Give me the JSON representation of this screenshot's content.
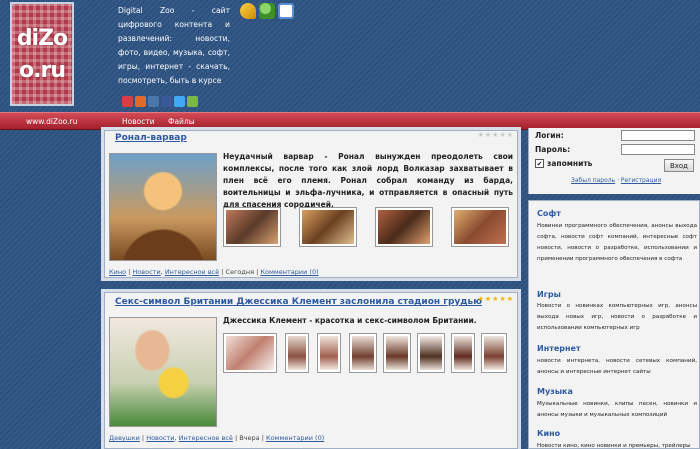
{
  "header": {
    "logo_text_1": "diZo",
    "logo_text_2": "o.ru",
    "description": "Digital Zoo - сайт цифрового контента и развлечений: новости, фото, видео, музыка, софт, игры, интернет - скачать, посмотреть, быть в курсе",
    "icons": [
      "key-icon",
      "user-add-icon",
      "rss-icon"
    ],
    "social_icons": [
      "social-icon-1",
      "social-icon-2",
      "vkontakte-icon",
      "facebook-icon",
      "twitter-icon",
      "friends-icon"
    ]
  },
  "nav": {
    "site": "www.diZoo.ru",
    "items": [
      "Новости",
      "Файлы"
    ]
  },
  "posts": [
    {
      "title": "Ронал-варвар",
      "rating": 0,
      "text": "Неудачный варвар - Ронал вынужден преодолеть свои комплексы, после того как злой лорд Волказар захватывает в плен всё его племя. Ронал собрал команду из барда, воительницы и эльфа-лучника, и отправляется в опасный путь для спасения сородичей.",
      "footer_links": [
        "Кино",
        "Новости",
        "Интересное всё"
      ],
      "footer_date": "Сегодня",
      "footer_comments": "Комментарии (0)"
    },
    {
      "title": "Секс-символ Британии Джессика Клемент заслонила стадион грудью",
      "rating": 5,
      "text": "Джессика Клемент - красотка и секс-символом Британии.",
      "footer_links": [
        "Девушки",
        "Новости",
        "Интересное всё"
      ],
      "footer_date": "Вчера",
      "footer_comments": "Комментарии (0)"
    }
  ],
  "login": {
    "login_label": "Логин:",
    "password_label": "Пароль:",
    "remember_label": "запомнить",
    "submit_label": "Вход",
    "forgot_link": "Забыл пароль",
    "separator": " · ",
    "register_link": "Регистрация"
  },
  "categories": [
    {
      "title": "Софт",
      "desc": "Новинки программного обеспечения, анонсы выхода софта, новости софт компаний, интересные софт новости, новости о разработке, использовании и применении программного обеспечения в софта"
    },
    {
      "title": "Игры",
      "desc": "Новости о новинках компьютерных игр, анонсы выхода новых игр, новости о разработке и использовании компьютерных игр"
    },
    {
      "title": "Интернет",
      "desc": "новости интернета, новости сетевых компаний, анонсы и интересные интернет сайты"
    },
    {
      "title": "Музыка",
      "desc": "Музыкальные новинки, клипы песен, новинки и анонсы музыки и музыкальных композиций"
    },
    {
      "title": "Кино",
      "desc": "Новости кино, кино новинки и премьеры, трейлеры"
    }
  ],
  "colors": {
    "background": "#2f5484",
    "nav_red": "#b52a36",
    "link_blue": "#2d5aa0"
  }
}
